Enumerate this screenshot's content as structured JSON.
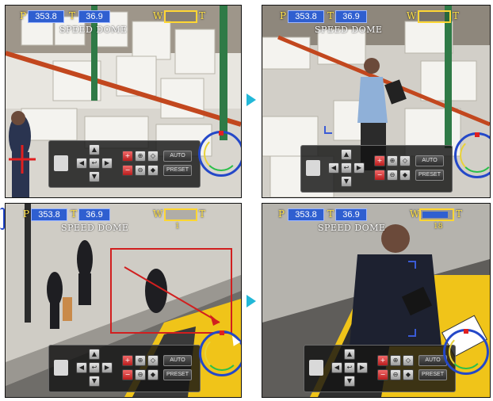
{
  "panels": [
    {
      "id": "top-left",
      "osd": {
        "pan_label": "P",
        "pan": "353.8",
        "tilt_label": "T",
        "tilt": "36.9",
        "title": "SPEED DOME",
        "zoom_label_w": "W",
        "zoom_label_t": "T",
        "zoom_level": "",
        "zoom_fraction": 0.0
      },
      "ptz": {
        "auto": "AUTO",
        "preset": "PRESET"
      }
    },
    {
      "id": "top-right",
      "osd": {
        "pan_label": "P",
        "pan": "353.8",
        "tilt_label": "T",
        "tilt": "36.9",
        "title": "SPEED DOME",
        "zoom_label_w": "W",
        "zoom_label_t": "T",
        "zoom_level": "",
        "zoom_fraction": 0.0
      },
      "ptz": {
        "auto": "AUTO",
        "preset": "PRESET"
      }
    },
    {
      "id": "bottom-left",
      "osd": {
        "pan_label": "P",
        "pan": "353.8",
        "tilt_label": "T",
        "tilt": "36.9",
        "title": "SPEED DOME",
        "zoom_label_w": "W",
        "zoom_label_t": "T",
        "zoom_level": "1",
        "zoom_fraction": 0.0
      },
      "ptz": {
        "auto": "AUTO",
        "preset": "PRESET"
      }
    },
    {
      "id": "bottom-right",
      "osd": {
        "pan_label": "P",
        "pan": "353.8",
        "tilt_label": "T",
        "tilt": "36.9",
        "title": "SPEED DOME",
        "zoom_label_w": "W",
        "zoom_label_t": "T",
        "zoom_level": "18",
        "zoom_fraction": 0.8
      },
      "ptz": {
        "auto": "AUTO",
        "preset": "PRESET"
      }
    }
  ],
  "colors": {
    "flow_arrow": "#22b8d8",
    "osd_box": "#2f5fd0",
    "gauge": "#ffd633",
    "selection": "#d11f1f"
  }
}
